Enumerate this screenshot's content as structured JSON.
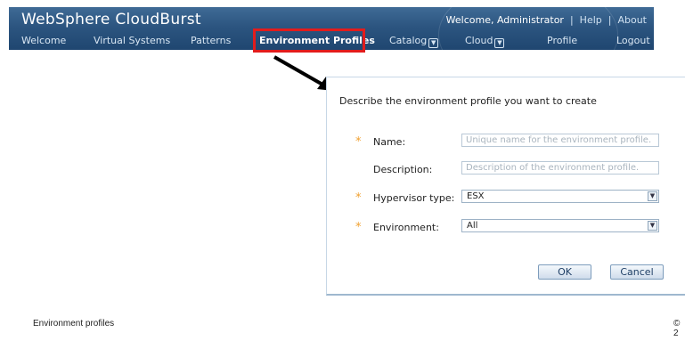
{
  "header": {
    "app_title": "WebSphere CloudBurst",
    "welcome": "Welcome, Administrator",
    "help": "Help",
    "about": "About",
    "separator": "|"
  },
  "nav": {
    "items": [
      {
        "label": "Welcome"
      },
      {
        "label": "Virtual Systems"
      },
      {
        "label": "Patterns"
      },
      {
        "label": "Environment Profiles"
      },
      {
        "label": "Catalog"
      },
      {
        "label": "Cloud"
      },
      {
        "label": "Profile"
      },
      {
        "label": "Logout"
      }
    ],
    "active": "Environment Profiles"
  },
  "dialog": {
    "title": "Describe the environment profile you want to create",
    "required_mark": "*",
    "name": {
      "label": "Name:",
      "placeholder": "Unique name for the environment profile.",
      "value": ""
    },
    "description": {
      "label": "Description:",
      "placeholder": "Description of the environment profile.",
      "value": ""
    },
    "hypervisor": {
      "label": "Hypervisor type:",
      "selected": "ESX"
    },
    "environment": {
      "label": "Environment:",
      "selected": "All"
    },
    "ok_label": "OK",
    "cancel_label": "Cancel"
  },
  "footer": {
    "left": "Environment profiles",
    "right": "© 2"
  },
  "colors": {
    "header_bg": "#2c5580",
    "highlight": "#e21c1c",
    "required": "#f0a030"
  }
}
